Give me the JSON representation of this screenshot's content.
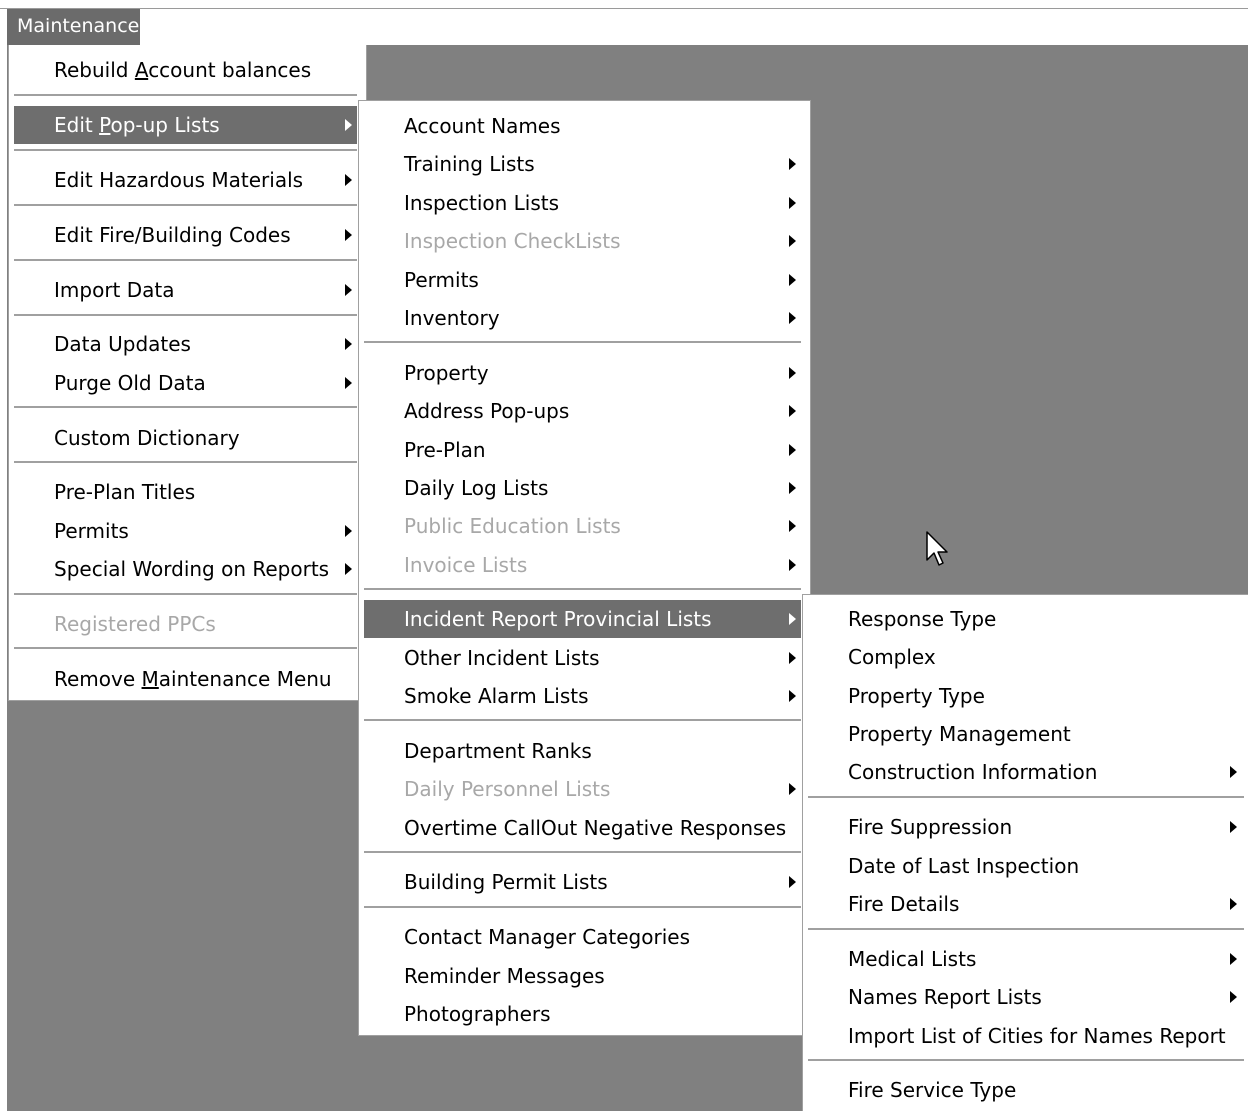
{
  "menubar": {
    "maintenance": "Maintenance"
  },
  "main_menu": {
    "rebuild_prefix": "Rebuild ",
    "rebuild_mnemonic": "A",
    "rebuild_suffix": "ccount balances",
    "edit_popup_prefix": "Edit ",
    "edit_popup_mnemonic": "P",
    "edit_popup_suffix": "op-up Lists",
    "edit_hazardous": "Edit Hazardous Materials",
    "edit_codes": "Edit Fire/Building Codes",
    "import_data": "Import Data",
    "data_updates": "Data Updates",
    "purge_old": "Purge Old Data",
    "custom_dictionary": "Custom Dictionary",
    "preplan_titles": "Pre-Plan Titles",
    "permits": "Permits",
    "special_wording": "Special Wording on Reports",
    "registered_ppcs": "Registered PPCs",
    "remove_prefix": "Remove ",
    "remove_mnemonic": "M",
    "remove_suffix": "aintenance Menu"
  },
  "popup_menu": {
    "account_names": "Account Names",
    "training_lists": "Training Lists",
    "inspection_lists": "Inspection Lists",
    "inspection_checklists": "Inspection CheckLists",
    "permits": "Permits",
    "inventory": "Inventory",
    "property": "Property",
    "address_popups": "Address Pop-ups",
    "pre_plan": "Pre-Plan",
    "daily_log": "Daily Log Lists",
    "public_education": "Public Education Lists",
    "invoice_lists": "Invoice Lists",
    "incident_provincial": "Incident Report Provincial Lists",
    "other_incident": "Other Incident Lists",
    "smoke_alarm": "Smoke Alarm Lists",
    "department_ranks": "Department Ranks",
    "daily_personnel": "Daily Personnel Lists",
    "overtime_callout": "Overtime CallOut Negative Responses",
    "building_permit": "Building Permit Lists",
    "contact_manager": "Contact Manager Categories",
    "reminder_messages": "Reminder Messages",
    "photographers": "Photographers"
  },
  "incident_menu": {
    "response_type": "Response Type",
    "complex": "Complex",
    "property_type": "Property Type",
    "property_management": "Property Management",
    "construction_information": "Construction Information",
    "fire_suppression": "Fire Suppression",
    "date_last_inspection": "Date of Last Inspection",
    "fire_details": "Fire Details",
    "medical_lists": "Medical Lists",
    "names_report_lists": "Names Report Lists",
    "import_cities": "Import List of Cities for Names Report",
    "fire_service_type": "Fire Service Type"
  },
  "colors": {
    "workspace": "#808080",
    "highlight": "#6e6e6e",
    "disabled_text": "#a8a8a8"
  },
  "icons": {
    "submenu": "submenu-arrow-icon",
    "cursor": "mouse-pointer-icon"
  }
}
